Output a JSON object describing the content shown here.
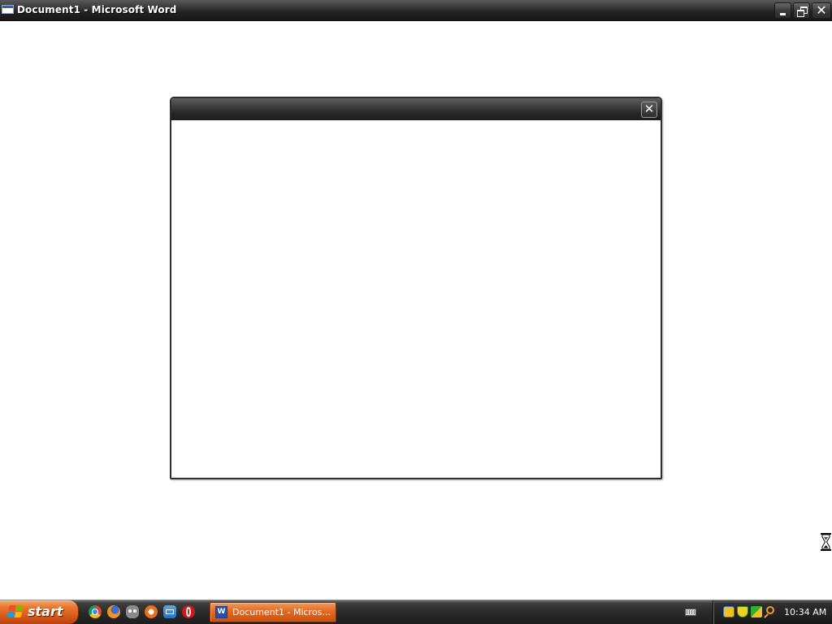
{
  "window": {
    "title": "Document1 - Microsoft Word",
    "app_icon": "document-window-icon",
    "controls": {
      "minimize_icon": "minimize-icon",
      "restore_icon": "restore-icon",
      "close_glyph": "✕"
    }
  },
  "dialog": {
    "title": "",
    "close_glyph": "✕"
  },
  "cursor": {
    "icon": "hourglass-busy-icon"
  },
  "taskbar": {
    "start_label": "start",
    "quick_launch": [
      "chrome-icon",
      "firefox-icon",
      "gimp-icon",
      "app-icon",
      "thunderbird-icon",
      "opera-icon"
    ],
    "tasks": [
      {
        "label": "Document1 - Microsof...",
        "icon": "word-icon",
        "active": true
      }
    ],
    "tray": {
      "icons": [
        "network-icon",
        "security-shield-icon",
        "update-icon",
        "search-icon"
      ],
      "clock": "10:34 AM"
    }
  },
  "colors": {
    "titlebar": "#2a2a2a",
    "taskbar": "#2a2a2a",
    "start_button": "#e26a22",
    "active_task": "#e26a22",
    "desktop": "#ffffff"
  }
}
